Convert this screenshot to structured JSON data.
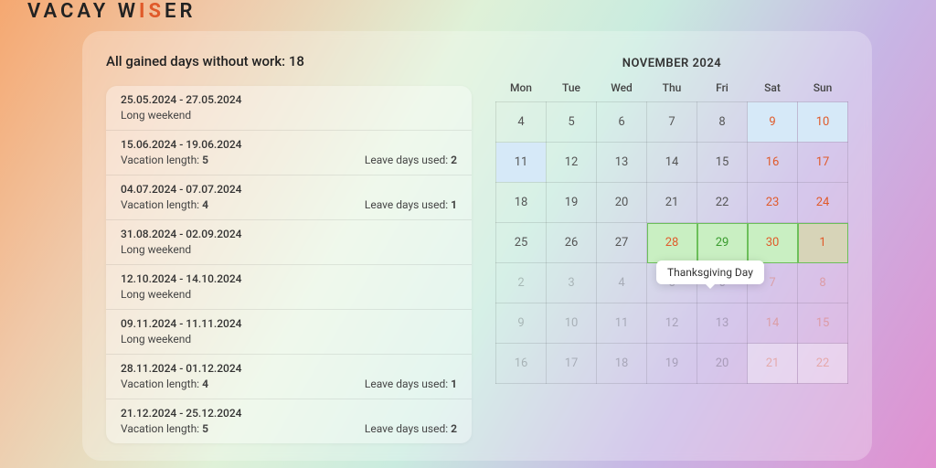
{
  "logo": {
    "pre": "VACAY W",
    "accent": "IS",
    "post": "ER"
  },
  "summary": {
    "label_prefix": "All gained days without work: ",
    "value": "18"
  },
  "list": [
    {
      "dates": "25.05.2024 - 27.05.2024",
      "sub": "Long weekend"
    },
    {
      "dates": "15.06.2024 - 19.06.2024",
      "sub": "Vacation length:",
      "sub_val": "5",
      "leave_label": "Leave days used:",
      "leave_val": "2"
    },
    {
      "dates": "04.07.2024 - 07.07.2024",
      "sub": "Vacation length:",
      "sub_val": "4",
      "leave_label": "Leave days used:",
      "leave_val": "1"
    },
    {
      "dates": "31.08.2024 - 02.09.2024",
      "sub": "Long weekend"
    },
    {
      "dates": "12.10.2024 - 14.10.2024",
      "sub": "Long weekend"
    },
    {
      "dates": "09.11.2024 - 11.11.2024",
      "sub": "Long weekend"
    },
    {
      "dates": "28.11.2024 - 01.12.2024",
      "sub": "Vacation length:",
      "sub_val": "4",
      "leave_label": "Leave days used:",
      "leave_val": "1"
    },
    {
      "dates": "21.12.2024 - 25.12.2024",
      "sub": "Vacation length:",
      "sub_val": "5",
      "leave_label": "Leave days used:",
      "leave_val": "2"
    }
  ],
  "calendar": {
    "title": "NOVEMBER 2024",
    "weekdays": [
      "Mon",
      "Tue",
      "Wed",
      "Thu",
      "Fri",
      "Sat",
      "Sun"
    ],
    "tooltip": "Thanksgiving Day",
    "rows": [
      [
        {
          "n": "4"
        },
        {
          "n": "5"
        },
        {
          "n": "6"
        },
        {
          "n": "7"
        },
        {
          "n": "8"
        },
        {
          "n": "9",
          "cls": "weekend highlight-blue"
        },
        {
          "n": "10",
          "cls": "weekend highlight-blue"
        }
      ],
      [
        {
          "n": "11",
          "cls": "highlight-blue"
        },
        {
          "n": "12"
        },
        {
          "n": "13"
        },
        {
          "n": "14"
        },
        {
          "n": "15"
        },
        {
          "n": "16",
          "cls": "weekend"
        },
        {
          "n": "17",
          "cls": "weekend"
        }
      ],
      [
        {
          "n": "18"
        },
        {
          "n": "19"
        },
        {
          "n": "20"
        },
        {
          "n": "21"
        },
        {
          "n": "22"
        },
        {
          "n": "23",
          "cls": "weekend"
        },
        {
          "n": "24",
          "cls": "weekend"
        }
      ],
      [
        {
          "n": "25"
        },
        {
          "n": "26"
        },
        {
          "n": "27"
        },
        {
          "n": "28",
          "cls": "weekend highlight-green"
        },
        {
          "n": "29",
          "cls": "highlight-green",
          "txt": "#3a9b2e"
        },
        {
          "n": "30",
          "cls": "weekend highlight-green"
        },
        {
          "n": "1",
          "cls": "weekend highlight-green highlight-green-weekend"
        }
      ],
      [
        {
          "n": "2",
          "cls": "muted"
        },
        {
          "n": "3",
          "cls": "muted"
        },
        {
          "n": "4",
          "cls": "muted"
        },
        {
          "n": "5",
          "cls": "muted"
        },
        {
          "n": "6",
          "cls": "muted"
        },
        {
          "n": "7",
          "cls": "muted weekend"
        },
        {
          "n": "8",
          "cls": "muted weekend"
        }
      ],
      [
        {
          "n": "9",
          "cls": "muted"
        },
        {
          "n": "10",
          "cls": "muted"
        },
        {
          "n": "11",
          "cls": "muted"
        },
        {
          "n": "12",
          "cls": "muted"
        },
        {
          "n": "13",
          "cls": "muted"
        },
        {
          "n": "14",
          "cls": "muted weekend"
        },
        {
          "n": "15",
          "cls": "muted weekend"
        }
      ],
      [
        {
          "n": "16",
          "cls": "muted"
        },
        {
          "n": "17",
          "cls": "muted"
        },
        {
          "n": "18",
          "cls": "muted"
        },
        {
          "n": "19",
          "cls": "muted"
        },
        {
          "n": "20",
          "cls": "muted"
        },
        {
          "n": "21",
          "cls": "muted weekend highlight-gray"
        },
        {
          "n": "22",
          "cls": "muted weekend highlight-gray"
        }
      ]
    ]
  }
}
